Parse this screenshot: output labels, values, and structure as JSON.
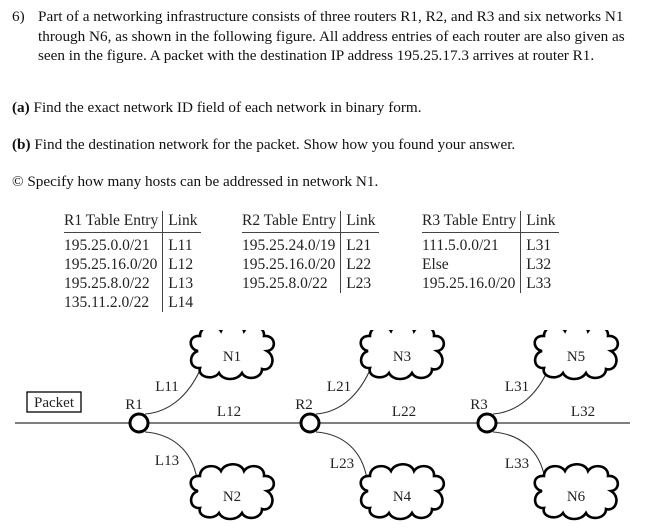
{
  "question": {
    "number": "6)",
    "text": "Part of a networking infrastructure consists of three routers R1, R2, and R3 and six networks N1 through N6, as shown in the following figure. All address entries of each router are also given as seen in the figure. A packet with the destination IP address 195.25.17.3 arrives at router R1."
  },
  "parts": [
    {
      "label": "(a)",
      "text": " Find the exact network ID field of each network in binary form."
    },
    {
      "label": "(b)",
      "text": " Find the destination network for the packet. Show how you found your answer."
    },
    {
      "label": "©",
      "text": " Specify how many hosts can be addressed in network N1."
    }
  ],
  "tables": [
    {
      "header": [
        "R1 Table Entry",
        "Link"
      ],
      "rows": [
        [
          "195.25.0.0/21",
          "L11"
        ],
        [
          "195.25.16.0/20",
          "L12"
        ],
        [
          "195.25.8.0/22",
          "L13"
        ],
        [
          "135.11.2.0/22",
          "L14"
        ]
      ]
    },
    {
      "header": [
        "R2 Table Entry",
        "Link"
      ],
      "rows": [
        [
          "195.25.24.0/19",
          "L21"
        ],
        [
          "195.25.16.0/20",
          "L22"
        ],
        [
          "195.25.8.0/22",
          "L23"
        ]
      ]
    },
    {
      "header": [
        "R3 Table Entry",
        "Link"
      ],
      "rows": [
        [
          "111.5.0.0/21",
          "L31"
        ],
        [
          "Else",
          "L32"
        ],
        [
          "195.25.16.0/20",
          "L33"
        ]
      ]
    }
  ],
  "diagram": {
    "packet_label": "Packet",
    "routers": [
      "R1",
      "R2",
      "R3"
    ],
    "networks": [
      "N1",
      "N2",
      "N3",
      "N4",
      "N5",
      "N6"
    ],
    "links": {
      "L11": "L11",
      "L12": "L12",
      "L13": "L13",
      "L21": "L21",
      "L22": "L22",
      "L23": "L23",
      "L31": "L31",
      "L32": "L32",
      "L33": "L33"
    }
  }
}
